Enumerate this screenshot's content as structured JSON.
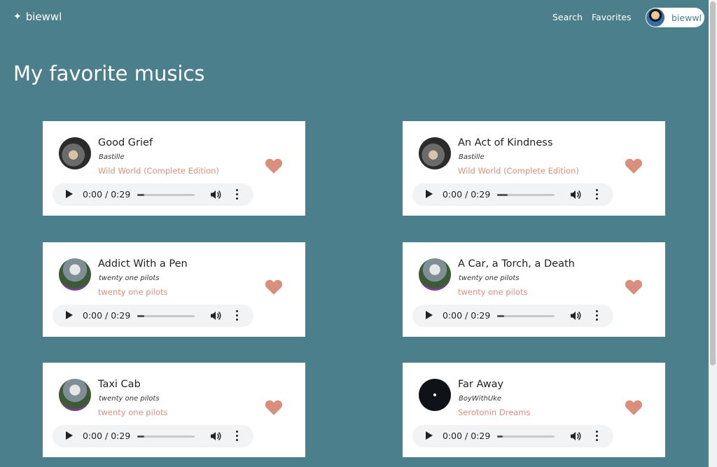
{
  "header": {
    "brand": "biewwl",
    "brand_icon": "sparkle-icon",
    "nav": {
      "search": "Search",
      "favorites": "Favorites"
    },
    "user": {
      "name": "biewwl"
    }
  },
  "page": {
    "title": "My favorite musics"
  },
  "colors": {
    "background": "#4b7f8b",
    "accent": "#d98f7b",
    "card": "#ffffff"
  },
  "songs": [
    {
      "title": "Good Grief",
      "artist": "Bastille",
      "album": "Wild World (Complete Edition)",
      "time": "0:00 / 0:29",
      "progress": 0.12,
      "favorited": true
    },
    {
      "title": "An Act of Kindness",
      "artist": "Bastille",
      "album": "Wild World (Complete Edition)",
      "time": "0:00 / 0:29",
      "progress": 0.18,
      "favorited": true
    },
    {
      "title": "Addict With a Pen",
      "artist": "twenty one pilots",
      "album": "twenty one pilots",
      "time": "0:00 / 0:29",
      "progress": 0.12,
      "favorited": true
    },
    {
      "title": "A Car, a Torch, a Death",
      "artist": "twenty one pilots",
      "album": "twenty one pilots",
      "time": "0:00 / 0:29",
      "progress": 0.12,
      "favorited": true
    },
    {
      "title": "Taxi Cab",
      "artist": "twenty one pilots",
      "album": "twenty one pilots",
      "time": "0:00 / 0:29",
      "progress": 0.12,
      "favorited": true
    },
    {
      "title": "Far Away",
      "artist": "BoyWithUke",
      "album": "Serotonin Dreams",
      "time": "0:00 / 0:29",
      "progress": 0.1,
      "favorited": true
    }
  ]
}
